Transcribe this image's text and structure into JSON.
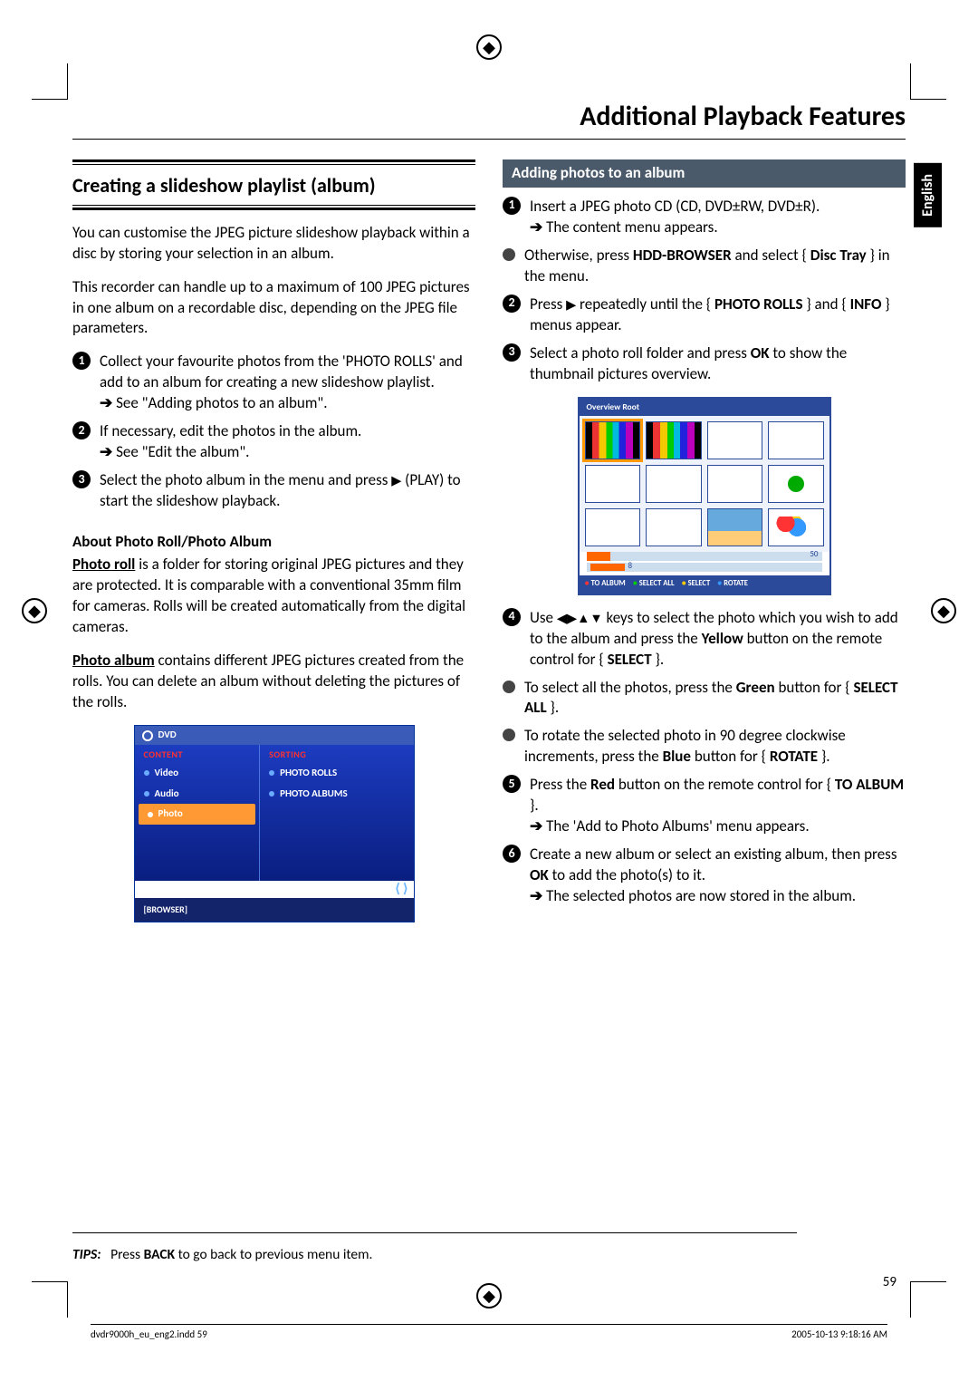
{
  "page_title": "Additional Playback Features",
  "language_tab": "English",
  "left": {
    "section_title": "Creating a slideshow playlist (album)",
    "para1": "You can customise the JPEG picture slideshow playback within a disc by storing your selection in an album.",
    "para2": "This recorder can handle up to a maximum of 100 JPEG pictures in one album on a recordable disc, depending on the JPEG file parameters.",
    "step1": "Collect your favourite photos from the 'PHOTO ROLLS' and add to an album for creating a new slideshow playlist.",
    "step1_sub": "See \"Adding photos to an album\".",
    "step2": "If necessary, edit the photos in the album.",
    "step2_sub": "See \"Edit the album\".",
    "step3a": "Select the photo album in the menu and press ",
    "step3b": " (PLAY) to start the slideshow playback.",
    "about_head": "About Photo Roll/Photo Album",
    "about_roll_label": "Photo roll",
    "about_roll": " is a folder for storing original JPEG pictures and they are protected. It is comparable with a conventional 35mm film for cameras. Rolls will be created automatically from the digital cameras.",
    "about_album_label": "Photo album",
    "about_album": " contains different JPEG pictures created from the rolls. You can delete an album without deleting the pictures of the rolls.",
    "dvd": {
      "top": "DVD",
      "content_h": "CONTENT",
      "video": "Video",
      "audio": "Audio",
      "photo": "Photo",
      "sorting_h": "SORTING",
      "rolls": "PHOTO ROLLS",
      "albums": "PHOTO ALBUMS",
      "browser": "[BROWSER]"
    }
  },
  "right": {
    "subhead": "Adding photos to an album",
    "s1a": "Insert a JPEG photo CD (CD, DVD±RW, DVD±R).",
    "s1b": "The content menu appears.",
    "bullet1a": "Otherwise, press ",
    "bullet1b": "HDD-BROWSER",
    "bullet1c": " and select { ",
    "bullet1d": "Disc Tray",
    "bullet1e": " } in the menu.",
    "s2a": "Press ",
    "s2b": " repeatedly until the { ",
    "s2c": "PHOTO ROLLS",
    "s2d": " } and { ",
    "s2e": "INFO",
    "s2f": " } menus appear.",
    "s3a": "Select a photo roll folder and press ",
    "s3b": "OK",
    "s3c": " to show the thumbnail pictures overview.",
    "ov": {
      "title": "Overview Root",
      "n50": "50",
      "n8": "8",
      "red": "TO ALBUM",
      "green": "SELECT ALL",
      "yellow": "SELECT",
      "blue": "ROTATE"
    },
    "s4a": "Use ",
    "s4b": " keys to select the photo which you wish to add to the album and press the ",
    "s4c": "Yellow",
    "s4d": " button on the remote control for { ",
    "s4e": "SELECT",
    "s4f": " }.",
    "b4a": "To select all the photos, press the ",
    "b4b": "Green",
    "b4c": " button for { ",
    "b4d": "SELECT ALL",
    "b4e": " }.",
    "b5a": "To rotate the selected photo in 90 degree clockwise increments, press the ",
    "b5b": "Blue",
    "b5c": " button for { ",
    "b5d": "ROTATE",
    "b5e": " }.",
    "s5a": "Press the ",
    "s5b": "Red",
    "s5c": " button on the remote control for { ",
    "s5d": "TO ALBUM",
    "s5e": " }.",
    "s5f": "The 'Add to Photo Albums' menu appears.",
    "s6a": "Create a new album or select an existing album, then press ",
    "s6b": "OK",
    "s6c": " to add the photo(s) to it.",
    "s6d": "The selected photos are now stored in the album."
  },
  "tips_label": "TIPS:",
  "tips_text_a": "Press ",
  "tips_text_b": "BACK",
  "tips_text_c": " to go back to previous menu item.",
  "page_number": "59",
  "footer_left": "dvdr9000h_eu_eng2.indd   59",
  "footer_right": "2005-10-13   9:18:16 AM"
}
